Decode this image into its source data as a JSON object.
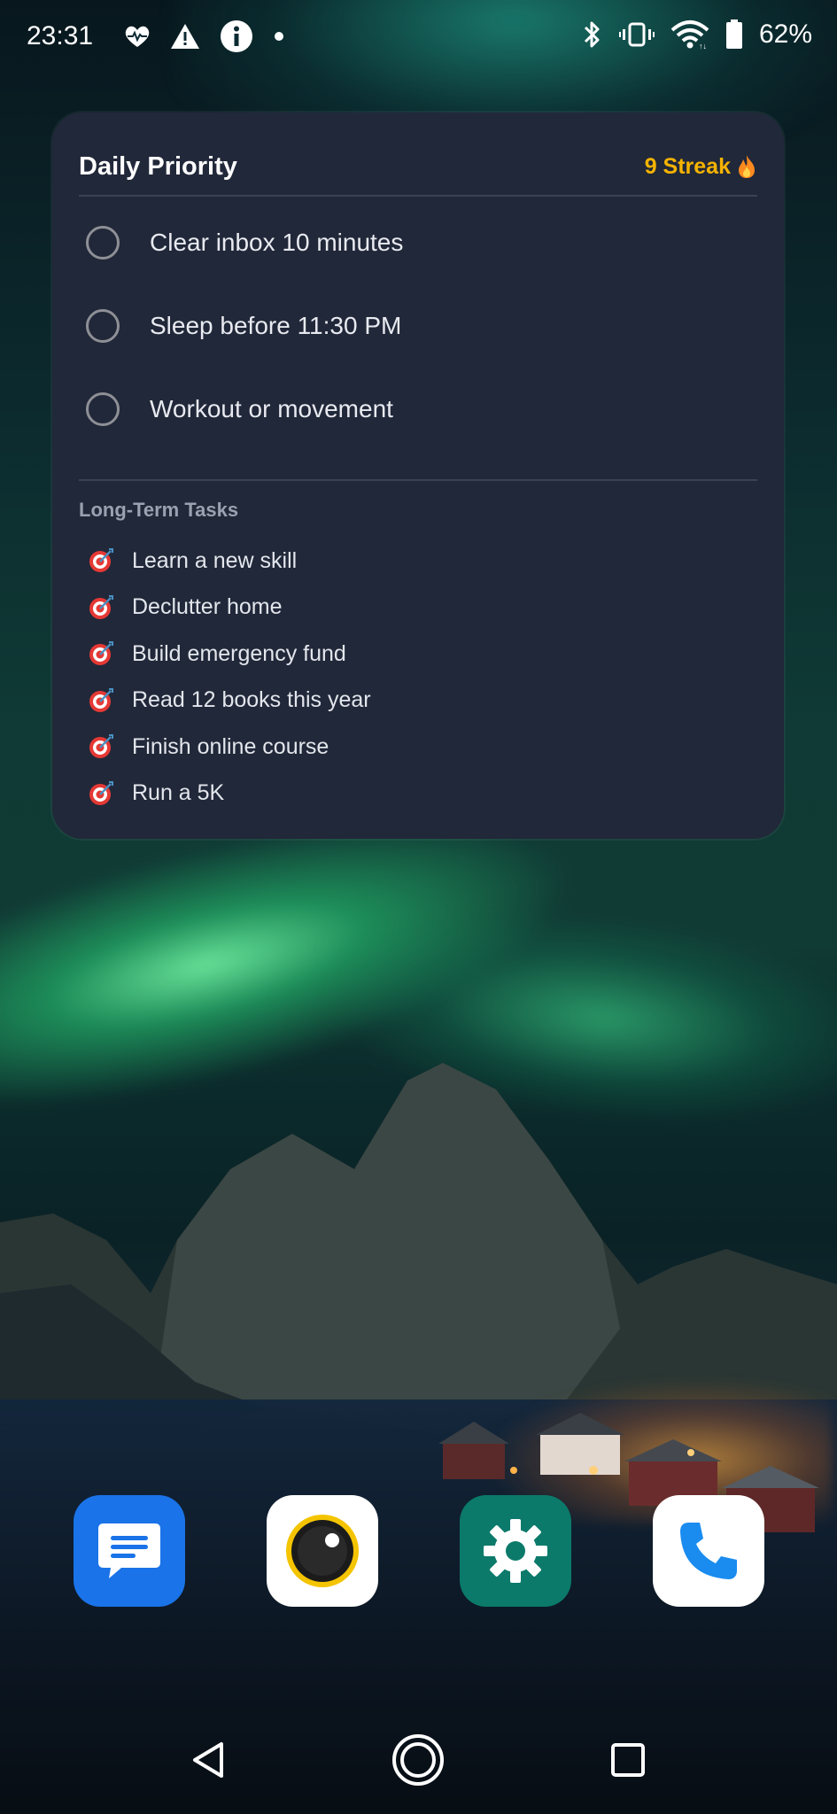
{
  "status_bar": {
    "time": "23:31",
    "battery_percent": "62%",
    "icons_left": [
      "heart-pulse-icon",
      "warning-icon",
      "info-icon",
      "dot-icon"
    ],
    "icons_right": [
      "bluetooth-icon",
      "vibrate-icon",
      "wifi-icon",
      "battery-icon"
    ]
  },
  "widget": {
    "title": "Daily Priority",
    "streak": "9 Streak",
    "streak_icon": "fire-icon",
    "daily_tasks": [
      {
        "label": "Clear inbox 10 minutes",
        "checked": false
      },
      {
        "label": "Sleep before 11:30 PM",
        "checked": false
      },
      {
        "label": "Workout or movement",
        "checked": false
      }
    ],
    "long_term_title": "Long-Term Tasks",
    "long_term_tasks": [
      "Learn a new skill",
      "Declutter home",
      "Build emergency fund",
      "Read 12 books this year",
      "Finish online course",
      "Run a 5K"
    ],
    "colors": {
      "background": "#212839",
      "streak": "#f6b300"
    }
  },
  "dock": {
    "apps": [
      {
        "name": "Messages",
        "icon": "messages-icon"
      },
      {
        "name": "Camera",
        "icon": "camera-icon"
      },
      {
        "name": "Settings",
        "icon": "settings-gear-icon"
      },
      {
        "name": "Phone",
        "icon": "phone-icon"
      }
    ]
  },
  "nav_bar": {
    "buttons": [
      "back-icon",
      "home-icon",
      "recents-icon"
    ]
  }
}
